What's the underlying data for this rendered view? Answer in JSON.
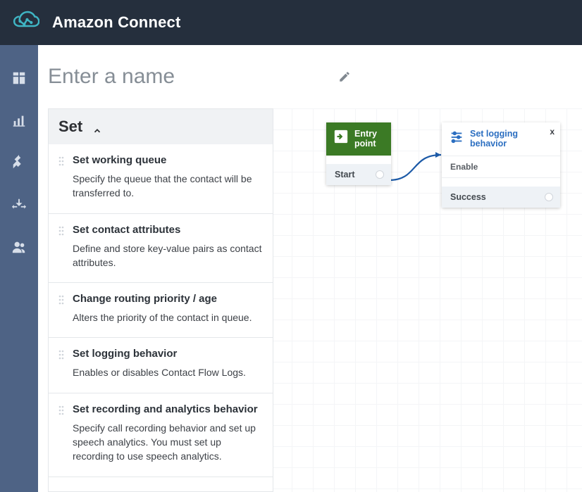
{
  "app": {
    "title": "Amazon Connect"
  },
  "page": {
    "name_placeholder": "Enter a name"
  },
  "panel": {
    "header": "Set",
    "items": [
      {
        "title": "Set working queue",
        "desc": "Specify the queue that the contact will be transferred to."
      },
      {
        "title": "Set contact attributes",
        "desc": "Define and store key-value pairs as contact attributes."
      },
      {
        "title": "Change routing priority / age",
        "desc": "Alters the priority of the contact in queue."
      },
      {
        "title": "Set logging behavior",
        "desc": "Enables or disables Contact Flow Logs."
      },
      {
        "title": "Set recording and analytics behavior",
        "desc": "Specify call recording behavior and set up speech analytics. You must set up recording to use speech analytics."
      }
    ]
  },
  "nodes": {
    "entry": {
      "title": "Entry point",
      "port": "Start"
    },
    "logging": {
      "title": "Set logging behavior",
      "sub": "Enable",
      "port": "Success",
      "close": "x"
    }
  }
}
